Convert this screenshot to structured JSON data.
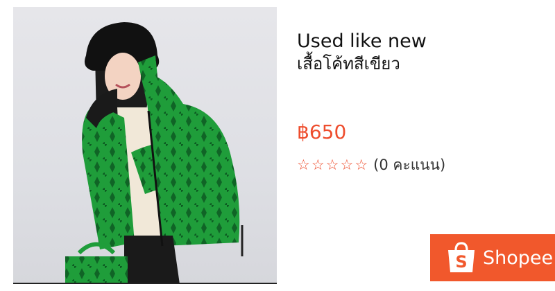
{
  "product": {
    "condition": "Used like new",
    "title": "เสื้อโค้ทสีเขียว",
    "price": "฿650",
    "rating": {
      "stars": [
        "☆",
        "☆",
        "☆",
        "☆",
        "☆"
      ],
      "text": "(0 คะแนน)"
    },
    "image": {
      "icon": "product-photo"
    }
  },
  "brand": {
    "name": "Shopee",
    "badge_letter": "S",
    "color": "#f1582c"
  },
  "colors": {
    "price": "#ee4d2d",
    "jacket": "#1f9d3a"
  }
}
